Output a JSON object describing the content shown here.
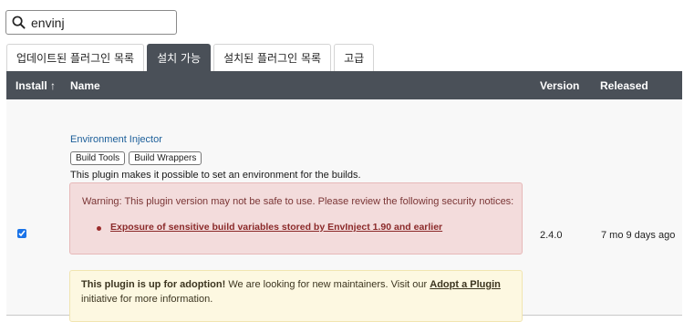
{
  "search": {
    "value": "envinj",
    "icon": "search-icon"
  },
  "tabs": [
    {
      "label": "업데이트된 플러그인 목록",
      "active": false
    },
    {
      "label": "설치 가능",
      "active": true
    },
    {
      "label": "설치된 플러그인 목록",
      "active": false
    },
    {
      "label": "고급",
      "active": false
    }
  ],
  "table": {
    "headers": {
      "install": "Install ↑",
      "name": "Name",
      "version": "Version",
      "released": "Released"
    },
    "rows": [
      {
        "checked": true,
        "name": "Environment Injector",
        "labels": [
          "Build Tools",
          "Build Wrappers"
        ],
        "description": "This plugin makes it possible to set an environment for the builds.",
        "warning": {
          "text": "Warning: This plugin version may not be safe to use. Please review the following security notices:",
          "links": [
            "Exposure of sensitive build variables stored by EnvInject 1.90 and earlier"
          ]
        },
        "adoption": {
          "title": "This plugin is up for adoption!",
          "text_before": " We are looking for new maintainers. Visit our ",
          "link": "Adopt a Plugin",
          "text_after": " initiative for more information."
        },
        "version": "2.4.0",
        "released": "7 mo 9 days ago"
      }
    ]
  },
  "colors": {
    "header_bg": "#4a5058",
    "link": "#1b5e99",
    "warning_bg": "#f3dcdc",
    "warning_text": "#8b2a2a",
    "adoption_bg": "#fdf8e1"
  }
}
